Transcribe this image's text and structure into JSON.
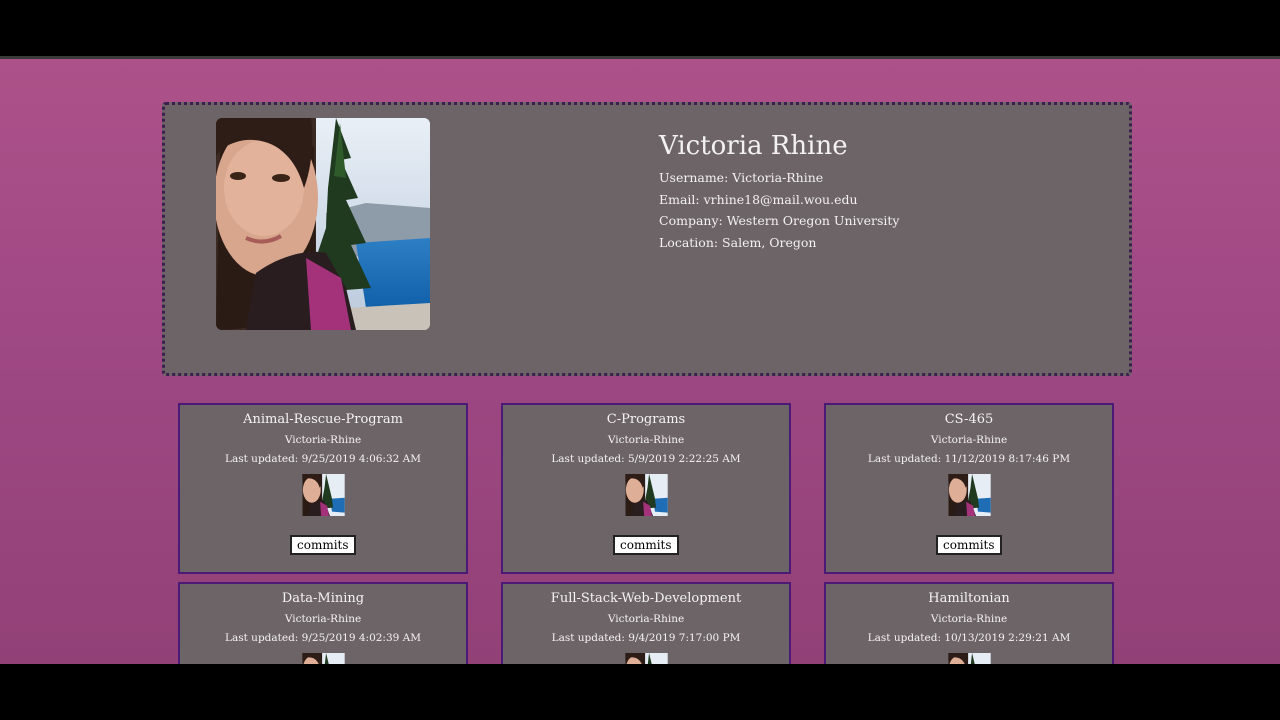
{
  "profile": {
    "name": "Victoria Rhine",
    "username_label": "Username: Victoria-Rhine",
    "email_label": "Email: vrhine18@mail.wou.edu",
    "company_label": "Company: Western Oregon University",
    "location_label": "Location: Salem, Oregon",
    "avatar_icon": "profile-photo"
  },
  "repos": [
    {
      "title": "Animal-Rescue-Program",
      "owner": "Victoria-Rhine",
      "updated": "Last updated: 9/25/2019 4:06:32 AM",
      "button": "commits"
    },
    {
      "title": "C-Programs",
      "owner": "Victoria-Rhine",
      "updated": "Last updated: 5/9/2019 2:22:25 AM",
      "button": "commits"
    },
    {
      "title": "CS-465",
      "owner": "Victoria-Rhine",
      "updated": "Last updated: 11/12/2019 8:17:46 PM",
      "button": "commits"
    },
    {
      "title": "Data-Mining",
      "owner": "Victoria-Rhine",
      "updated": "Last updated: 9/25/2019 4:02:39 AM"
    },
    {
      "title": "Full-Stack-Web-Development",
      "owner": "Victoria-Rhine",
      "updated": "Last updated: 9/4/2019 7:17:00 PM"
    },
    {
      "title": "Hamiltonian",
      "owner": "Victoria-Rhine",
      "updated": "Last updated: 10/13/2019 2:29:21 AM"
    }
  ],
  "colors": {
    "background_top": "#ad5189",
    "background_bottom": "#924177",
    "card": "#6c6466",
    "card_border": "#4b1a76",
    "profile_border": "#3c1f4e"
  }
}
